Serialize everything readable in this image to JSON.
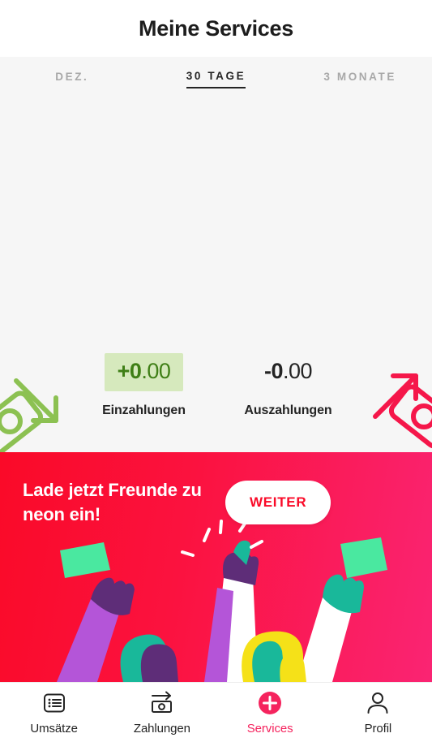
{
  "header": {
    "title": "Meine Services"
  },
  "period": {
    "tabs": [
      {
        "label": "DEZ.",
        "active": false
      },
      {
        "label": "30 TAGE",
        "active": true
      },
      {
        "label": "3 MONATE",
        "active": false
      }
    ]
  },
  "chart_data": {
    "type": "bar",
    "title": "",
    "categories": [],
    "values": [],
    "xlabel": "",
    "ylabel": "",
    "grid": false,
    "empty": true,
    "note": "Empty chart region, no bars or axis ticks rendered"
  },
  "summary": {
    "incoming": {
      "major": "+0",
      "minor": ".00",
      "label": "Einzahlungen",
      "icon": "banknote-arrow-down-icon",
      "color": "#3f7f16",
      "highlight": "#d6e9bd"
    },
    "outgoing": {
      "major": "-0",
      "minor": ".00",
      "label": "Auszahlungen",
      "icon": "banknote-arrow-up-icon",
      "color": "#242424"
    }
  },
  "promo": {
    "text": "Lade jetzt Freunde zu neon ein!",
    "cta_label": "WEITER",
    "gradient_from": "#fa0a28",
    "gradient_to": "#fa2473",
    "cta_text_color": "#fa0a28"
  },
  "bottomnav": {
    "items": [
      {
        "label": "Umsätze",
        "icon": "list-icon",
        "active": false
      },
      {
        "label": "Zahlungen",
        "icon": "banknote-send-icon",
        "active": false
      },
      {
        "label": "Services",
        "icon": "plus-circle-icon",
        "active": true
      },
      {
        "label": "Profil",
        "icon": "person-icon",
        "active": false
      }
    ],
    "active_color": "#f5245e"
  }
}
